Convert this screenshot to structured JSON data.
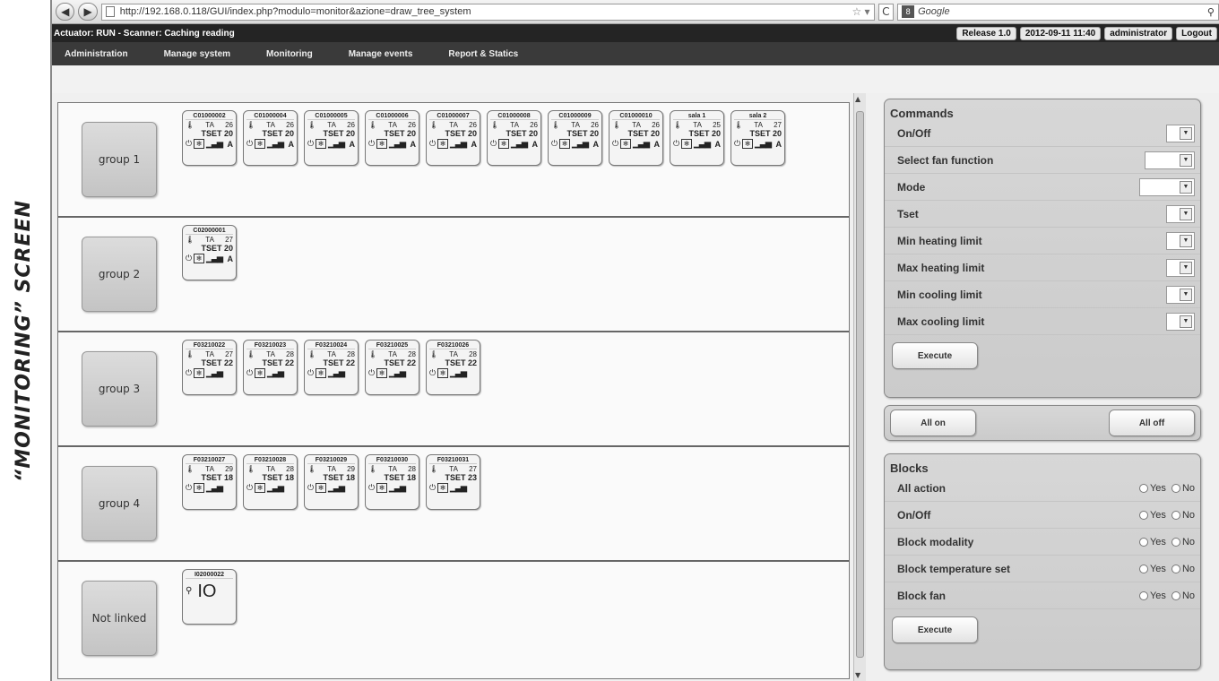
{
  "caption": "“MONITORING” SCREEN",
  "browser": {
    "url": "http://192.168.0.118/GUI/index.php?modulo=monitor&azione=draw_tree_system",
    "search_placeholder": "Google"
  },
  "status": {
    "left": "Actuator: RUN - Scanner: Caching reading",
    "release": "Release 1.0",
    "datetime": "2012-09-11 11:40",
    "user": "administrator",
    "logout": "Logout"
  },
  "menu": [
    "Administration",
    "Manage system",
    "Monitoring",
    "Manage events",
    "Report & Statics"
  ],
  "groups": [
    {
      "label": "group 1",
      "devices": [
        {
          "id": "C01000002",
          "ta": "26",
          "tset": "TSET 20",
          "mode": "A"
        },
        {
          "id": "C01000004",
          "ta": "26",
          "tset": "TSET 20",
          "mode": "A"
        },
        {
          "id": "C01000005",
          "ta": "26",
          "tset": "TSET 20",
          "mode": "A"
        },
        {
          "id": "C01000006",
          "ta": "26",
          "tset": "TSET 20",
          "mode": "A"
        },
        {
          "id": "C01000007",
          "ta": "26",
          "tset": "TSET 20",
          "mode": "A"
        },
        {
          "id": "C01000008",
          "ta": "26",
          "tset": "TSET 20",
          "mode": "A"
        },
        {
          "id": "C01000009",
          "ta": "26",
          "tset": "TSET 20",
          "mode": "A"
        },
        {
          "id": "C01000010",
          "ta": "26",
          "tset": "TSET 20",
          "mode": "A"
        },
        {
          "id": "sala 1",
          "ta": "25",
          "tset": "TSET 20",
          "mode": "A"
        },
        {
          "id": "sala 2",
          "ta": "27",
          "tset": "TSET 20",
          "mode": "A"
        }
      ]
    },
    {
      "label": "group 2",
      "devices": [
        {
          "id": "C02000001",
          "ta": "27",
          "tset": "TSET 20",
          "mode": "A"
        }
      ]
    },
    {
      "label": "group 3",
      "devices": [
        {
          "id": "F03210022",
          "ta": "27",
          "tset": "TSET 22",
          "mode": ""
        },
        {
          "id": "F03210023",
          "ta": "28",
          "tset": "TSET 22",
          "mode": ""
        },
        {
          "id": "F03210024",
          "ta": "28",
          "tset": "TSET 22",
          "mode": ""
        },
        {
          "id": "F03210025",
          "ta": "28",
          "tset": "TSET 22",
          "mode": ""
        },
        {
          "id": "F03210026",
          "ta": "28",
          "tset": "TSET 22",
          "mode": ""
        }
      ]
    },
    {
      "label": "group 4",
      "devices": [
        {
          "id": "F03210027",
          "ta": "29",
          "tset": "TSET 18",
          "mode": ""
        },
        {
          "id": "F03210028",
          "ta": "28",
          "tset": "TSET 18",
          "mode": ""
        },
        {
          "id": "F03210029",
          "ta": "29",
          "tset": "TSET 18",
          "mode": ""
        },
        {
          "id": "F03210030",
          "ta": "28",
          "tset": "TSET 18",
          "mode": ""
        },
        {
          "id": "F03210031",
          "ta": "27",
          "tset": "TSET 23",
          "mode": ""
        }
      ]
    },
    {
      "label": "Not linked",
      "devices": []
    }
  ],
  "io_device": {
    "id": "I02000022",
    "value": "IO"
  },
  "ta_label": "TA",
  "commands": {
    "title": "Commands",
    "rows": [
      "On/Off",
      "Select fan function",
      "Mode",
      "Tset",
      "Min heating limit",
      "Max heating limit",
      "Min cooling limit",
      "Max cooling limit"
    ],
    "execute": "Execute"
  },
  "all_on": "All on",
  "all_off": "All off",
  "blocks": {
    "title": "Blocks",
    "rows": [
      "All action",
      "On/Off",
      "Block modality",
      "Block temperature set",
      "Block fan"
    ],
    "yes": "Yes",
    "no": "No",
    "execute": "Execute"
  }
}
